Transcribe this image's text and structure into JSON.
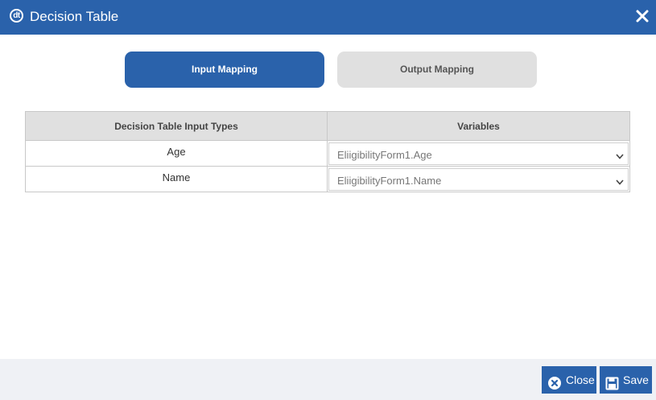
{
  "dialog": {
    "title": "Decision Table",
    "logo_text": "dt"
  },
  "tabs": [
    {
      "label": "Input Mapping",
      "active": true
    },
    {
      "label": "Output Mapping",
      "active": false
    }
  ],
  "table": {
    "headers": [
      "Decision Table Input Types",
      "Variables"
    ],
    "rows": [
      {
        "type": "Age",
        "variable": "EliigibilityForm1.Age"
      },
      {
        "type": "Name",
        "variable": "EliigibilityForm1.Name"
      }
    ]
  },
  "footer": {
    "close_label": "Close",
    "save_label": "Save"
  },
  "colors": {
    "primary": "#2a62ab",
    "inactive_tab": "#e0e0e0",
    "footer_bg": "#eff1f5"
  },
  "icons": {
    "title_close": "close-icon",
    "select": "chevron-down-icon",
    "close_button": "circle-x-icon",
    "save_button": "floppy-disk-icon"
  }
}
